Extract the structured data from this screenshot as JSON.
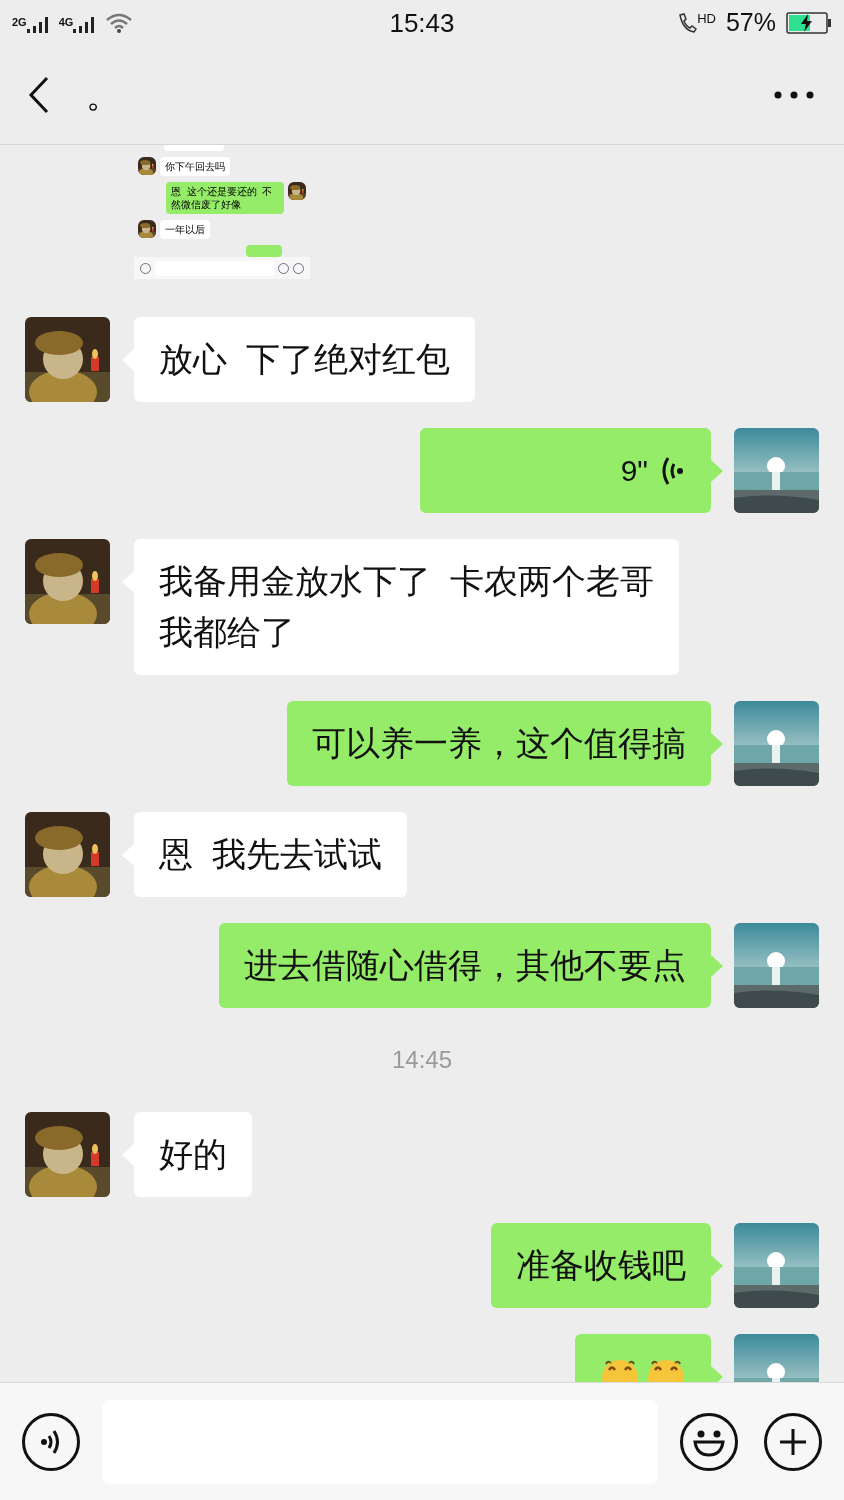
{
  "status_bar": {
    "network_1": "2G",
    "network_2": "4G",
    "time": "15:43",
    "call_badge": "HD",
    "battery": "57%",
    "charging": true
  },
  "header": {
    "title": "。"
  },
  "messages": [
    {
      "outgoing": false,
      "thumb_messages": [
        {
          "outgoing": false,
          "text": "你下午回去吗"
        },
        {
          "outgoing": true,
          "text": "恩  这个还是要还的  不然微信废了好像"
        },
        {
          "outgoing": false,
          "text": "一年以后"
        }
      ]
    },
    {
      "kind": "text",
      "outgoing": false,
      "lines": [
        "放心  下了绝对红包"
      ]
    },
    {
      "kind": "voice",
      "outgoing": true,
      "duration": "9\""
    },
    {
      "kind": "text",
      "outgoing": false,
      "lines": [
        "我备用金放水下了  卡农两个老哥",
        "我都给了"
      ]
    },
    {
      "kind": "text",
      "outgoing": true,
      "lines": [
        "可以养一养，这个值得搞"
      ]
    },
    {
      "kind": "text",
      "outgoing": false,
      "lines": [
        "恩  我先去试试"
      ]
    },
    {
      "kind": "text",
      "outgoing": true,
      "lines": [
        "进去借随心借得，其他不要点"
      ]
    },
    {
      "kind": "time",
      "text": "14:45"
    },
    {
      "kind": "text",
      "outgoing": false,
      "lines": [
        "好的"
      ]
    },
    {
      "kind": "text",
      "outgoing": true,
      "lines": [
        "准备收钱吧"
      ]
    },
    {
      "kind": "emoji",
      "outgoing": true
    }
  ]
}
